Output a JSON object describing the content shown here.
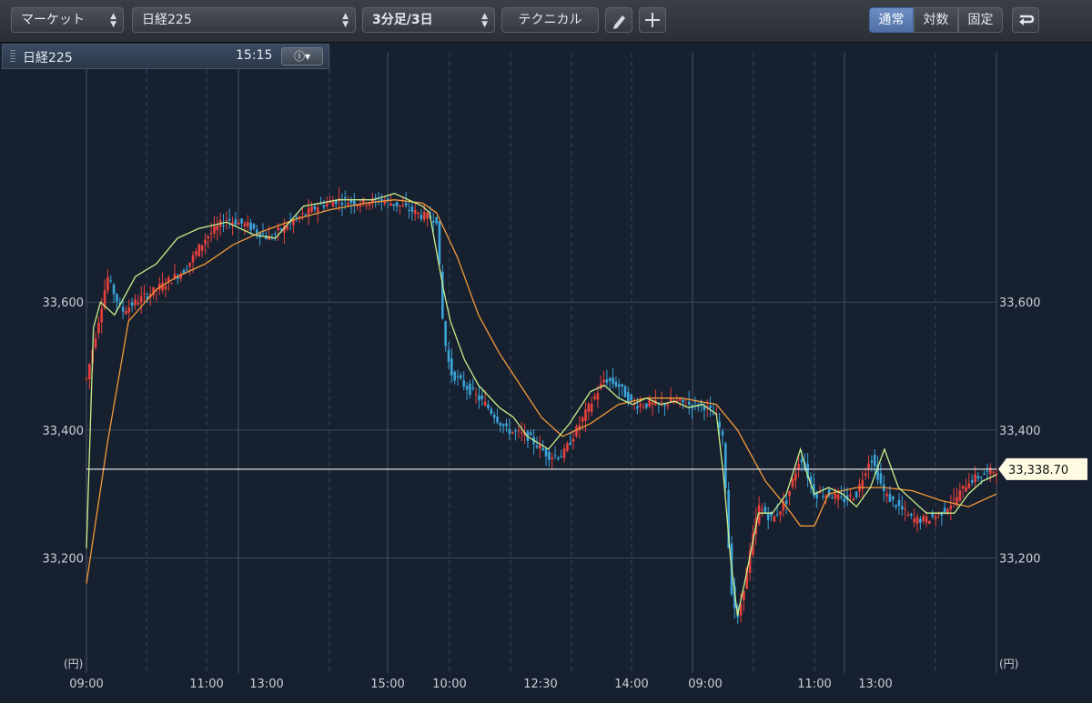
{
  "toolbar": {
    "market_select": "マーケット",
    "symbol_select": "日経225",
    "period_select": "3分足/3日",
    "technical_button": "テクニカル",
    "scale_normal": "通常",
    "scale_log": "対数",
    "scale_fixed": "固定"
  },
  "infobar": {
    "symbol": "日経225",
    "time": "15:15"
  },
  "chart_data": {
    "type": "candlestick",
    "ylim": [
      33020,
      33990
    ],
    "y_ticks": [
      33200,
      33400,
      33600
    ],
    "y_tick_labels": [
      "33,200",
      "33,400",
      "33,600"
    ],
    "unit_label": "(円)",
    "x_tick_labels": [
      "09:00",
      "11:00",
      "13:00",
      "15:00",
      "10:00",
      "12:30",
      "14:00",
      "09:00",
      "11:00",
      "13:00"
    ],
    "current_price": 33338.7,
    "current_price_label": "33,338.70",
    "colors": {
      "up": "#e8413c",
      "down": "#3aa3d9",
      "ma_short": "#c9f08a",
      "ma_long": "#f39a3a",
      "price_line": "#f2f2f2",
      "price_tag": "#fffbe3"
    },
    "price_path": [
      [
        0,
        33480
      ],
      [
        3,
        33640
      ],
      [
        5,
        33585
      ],
      [
        7,
        33600
      ],
      [
        10,
        33620
      ],
      [
        14,
        33650
      ],
      [
        17,
        33700
      ],
      [
        20,
        33730
      ],
      [
        23,
        33720
      ],
      [
        26,
        33700
      ],
      [
        30,
        33730
      ],
      [
        33,
        33750
      ],
      [
        36,
        33760
      ],
      [
        39,
        33755
      ],
      [
        42,
        33760
      ],
      [
        45,
        33750
      ],
      [
        48,
        33735
      ],
      [
        50,
        33730
      ],
      [
        51,
        33550
      ],
      [
        52,
        33490
      ],
      [
        54,
        33470
      ],
      [
        57,
        33440
      ],
      [
        60,
        33400
      ],
      [
        63,
        33390
      ],
      [
        66,
        33360
      ],
      [
        68,
        33360
      ],
      [
        70,
        33400
      ],
      [
        72,
        33440
      ],
      [
        74,
        33480
      ],
      [
        76,
        33470
      ],
      [
        78,
        33440
      ],
      [
        80,
        33440
      ],
      [
        82,
        33440
      ],
      [
        84,
        33445
      ],
      [
        86,
        33440
      ],
      [
        88,
        33440
      ],
      [
        90,
        33420
      ],
      [
        91,
        33380
      ],
      [
        92,
        33160
      ],
      [
        93,
        33100
      ],
      [
        94,
        33160
      ],
      [
        96,
        33280
      ],
      [
        98,
        33260
      ],
      [
        100,
        33290
      ],
      [
        102,
        33360
      ],
      [
        104,
        33300
      ],
      [
        106,
        33300
      ],
      [
        108,
        33290
      ],
      [
        110,
        33300
      ],
      [
        112,
        33360
      ],
      [
        114,
        33300
      ],
      [
        116,
        33280
      ],
      [
        118,
        33260
      ],
      [
        120,
        33260
      ],
      [
        122,
        33270
      ],
      [
        124,
        33290
      ],
      [
        126,
        33320
      ],
      [
        128,
        33330
      ],
      [
        130,
        33338.7
      ]
    ],
    "ma_short": [
      [
        0,
        33215
      ],
      [
        1,
        33560
      ],
      [
        2,
        33600
      ],
      [
        4,
        33580
      ],
      [
        7,
        33640
      ],
      [
        10,
        33660
      ],
      [
        13,
        33700
      ],
      [
        16,
        33715
      ],
      [
        20,
        33725
      ],
      [
        24,
        33705
      ],
      [
        27,
        33700
      ],
      [
        31,
        33750
      ],
      [
        36,
        33760
      ],
      [
        41,
        33760
      ],
      [
        44,
        33770
      ],
      [
        48,
        33750
      ],
      [
        49,
        33740
      ],
      [
        51,
        33620
      ],
      [
        52,
        33570
      ],
      [
        54,
        33510
      ],
      [
        56,
        33470
      ],
      [
        59,
        33435
      ],
      [
        61,
        33420
      ],
      [
        63,
        33390
      ],
      [
        66,
        33370
      ],
      [
        69,
        33410
      ],
      [
        72,
        33460
      ],
      [
        74,
        33470
      ],
      [
        76,
        33450
      ],
      [
        78,
        33440
      ],
      [
        80,
        33450
      ],
      [
        82,
        33440
      ],
      [
        84,
        33445
      ],
      [
        86,
        33435
      ],
      [
        88,
        33440
      ],
      [
        90,
        33425
      ],
      [
        91,
        33330
      ],
      [
        92,
        33200
      ],
      [
        93,
        33110
      ],
      [
        94,
        33160
      ],
      [
        96,
        33270
      ],
      [
        98,
        33270
      ],
      [
        100,
        33300
      ],
      [
        102,
        33370
      ],
      [
        103,
        33330
      ],
      [
        104,
        33300
      ],
      [
        106,
        33310
      ],
      [
        108,
        33300
      ],
      [
        110,
        33280
      ],
      [
        112,
        33310
      ],
      [
        114,
        33370
      ],
      [
        116,
        33310
      ],
      [
        118,
        33290
      ],
      [
        120,
        33270
      ],
      [
        122,
        33270
      ],
      [
        124,
        33270
      ],
      [
        126,
        33300
      ],
      [
        128,
        33320
      ],
      [
        130,
        33330
      ]
    ],
    "ma_long": [
      [
        0,
        33160
      ],
      [
        3,
        33380
      ],
      [
        6,
        33570
      ],
      [
        10,
        33620
      ],
      [
        13,
        33640
      ],
      [
        17,
        33660
      ],
      [
        21,
        33690
      ],
      [
        25,
        33710
      ],
      [
        30,
        33730
      ],
      [
        35,
        33745
      ],
      [
        40,
        33755
      ],
      [
        44,
        33760
      ],
      [
        48,
        33755
      ],
      [
        50,
        33740
      ],
      [
        53,
        33670
      ],
      [
        56,
        33580
      ],
      [
        59,
        33520
      ],
      [
        62,
        33470
      ],
      [
        65,
        33420
      ],
      [
        68,
        33390
      ],
      [
        72,
        33410
      ],
      [
        76,
        33440
      ],
      [
        80,
        33450
      ],
      [
        85,
        33450
      ],
      [
        90,
        33440
      ],
      [
        93,
        33400
      ],
      [
        97,
        33320
      ],
      [
        100,
        33280
      ],
      [
        102,
        33250
      ],
      [
        104,
        33250
      ],
      [
        106,
        33300
      ],
      [
        110,
        33310
      ],
      [
        114,
        33310
      ],
      [
        118,
        33305
      ],
      [
        122,
        33290
      ],
      [
        126,
        33280
      ],
      [
        130,
        33300
      ]
    ]
  }
}
